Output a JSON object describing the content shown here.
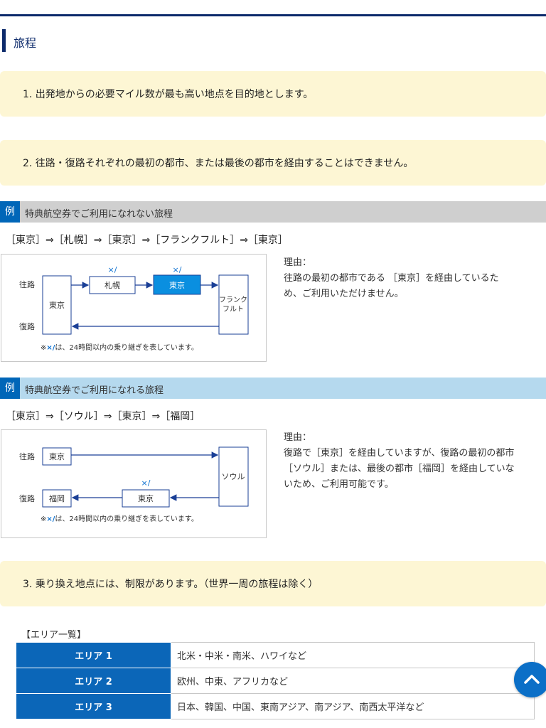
{
  "section": {
    "title": "旅程"
  },
  "rules": [
    "1.  出発地からの必要マイル数が最も高い地点を目的地とします。",
    "2.  往路・復路それぞれの最初の都市、または最後の都市を経由することはできません。",
    "3.  乗り換え地点には、制限があります。（世界一周の旅程は除く）"
  ],
  "example_badge": "例",
  "example_ng": {
    "heading": "特典航空券でご利用になれない旅程",
    "route": "［東京］⇒［札幌］⇒［東京］⇒［フランクフルト］⇒［東京］",
    "diagram": {
      "outbound": "往路",
      "return": "復路",
      "tokyo": "東京",
      "sapporo": "札幌",
      "tokyo2": "東京",
      "frankfurt_line1": "フランク",
      "frankfurt_line2": "フルト",
      "mark": "×/",
      "note_prefix": "※",
      "note_mark": "×/",
      "note_text": "は、24時間以内の乗り継ぎを表しています。"
    },
    "reason_title": "理由：",
    "reason_lines": [
      "往路の最初の都市である ［東京］を経由しているた",
      "め、ご利用いただけません。"
    ]
  },
  "example_ok": {
    "heading": "特典航空券でご利用になれる旅程",
    "route": "［東京］⇒［ソウル］⇒［東京］⇒［福岡］",
    "diagram": {
      "outbound": "往路",
      "return": "復路",
      "tokyo": "東京",
      "seoul": "ソウル",
      "fukuoka": "福岡",
      "tokyo2": "東京",
      "mark": "×/",
      "note_prefix": "※",
      "note_mark": "×/",
      "note_text": "は、24時間以内の乗り継ぎを表しています。"
    },
    "reason_title": "理由：",
    "reason_lines": [
      "復路で［東京］を経由していますが、復路の最初の都市",
      "［ソウル］または、最後の都市［福岡］を経由していな",
      "いため、ご利用可能です。"
    ]
  },
  "area_caption": "【エリア一覧】",
  "areas": [
    {
      "name": "エリア 1",
      "regions": "北米・中米・南米、ハワイなど"
    },
    {
      "name": "エリア 2",
      "regions": "欧州、中東、アフリカなど"
    },
    {
      "name": "エリア 3",
      "regions": "日本、韓国、中国、東南アジア、南アジア、南西太平洋など"
    }
  ],
  "colors": {
    "navy": "#0c2a6b",
    "accent_blue": "#0b66b8",
    "highlight_blue": "#0a8fe0",
    "rule_bg": "#fdf6d4",
    "ng_bg": "#cfcfcf",
    "ok_bg": "#b5d9ee"
  },
  "icons": {
    "scroll_top": "chevron-up-icon"
  }
}
